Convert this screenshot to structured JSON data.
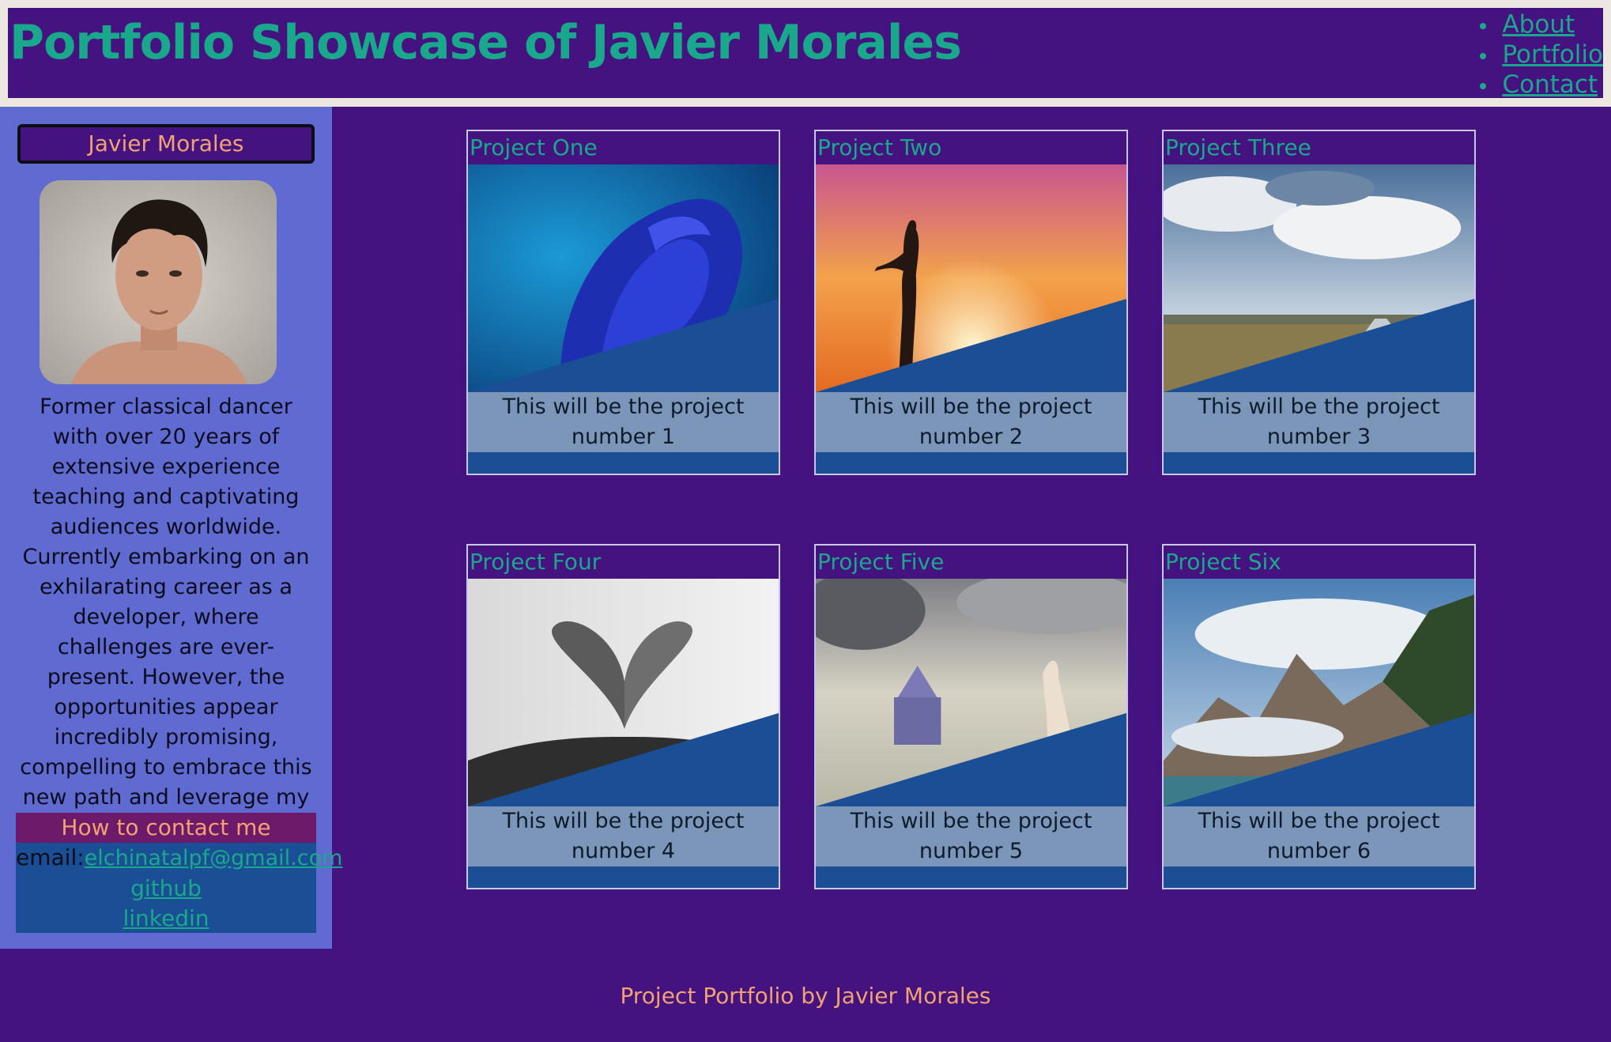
{
  "header": {
    "title": "Portfolio Showcase of Javier Morales",
    "nav": [
      "About",
      "Portfolio",
      "Contact"
    ]
  },
  "sidebar": {
    "name": "Javier Morales",
    "bio": "Former classical dancer with over 20 years of extensive experience teaching and captivating audiences worldwide. Currently embarking on an exhilarating career as a developer, where challenges are ever-present. However, the opportunities appear incredibly promising, compelling to embrace this new path and leverage my extraordinary background to reach greater heights.",
    "contact": {
      "heading": "How to contact me",
      "email_label": "email:",
      "email": "elchinatalpf@gmail.com",
      "github": "github",
      "linkedin": "linkedin"
    }
  },
  "projects": [
    {
      "title": "Project One",
      "desc": "This will be the project number 1"
    },
    {
      "title": "Project Two",
      "desc": "This will be the project number 2"
    },
    {
      "title": "Project Three",
      "desc": "This will be the project number 3"
    },
    {
      "title": "Project Four",
      "desc": "This will be the project number 4"
    },
    {
      "title": "Project Five",
      "desc": "This will be the project number 5"
    },
    {
      "title": "Project Six",
      "desc": "This will be the project number 6"
    }
  ],
  "footer": "Project Portfolio by Javier Morales",
  "colors": {
    "page_bg": "#441380",
    "accent_teal": "#1aa88c",
    "accent_orange": "#f2a272",
    "sidebar_bg": "#5f6bd1",
    "card_blue": "#1b4f95"
  }
}
